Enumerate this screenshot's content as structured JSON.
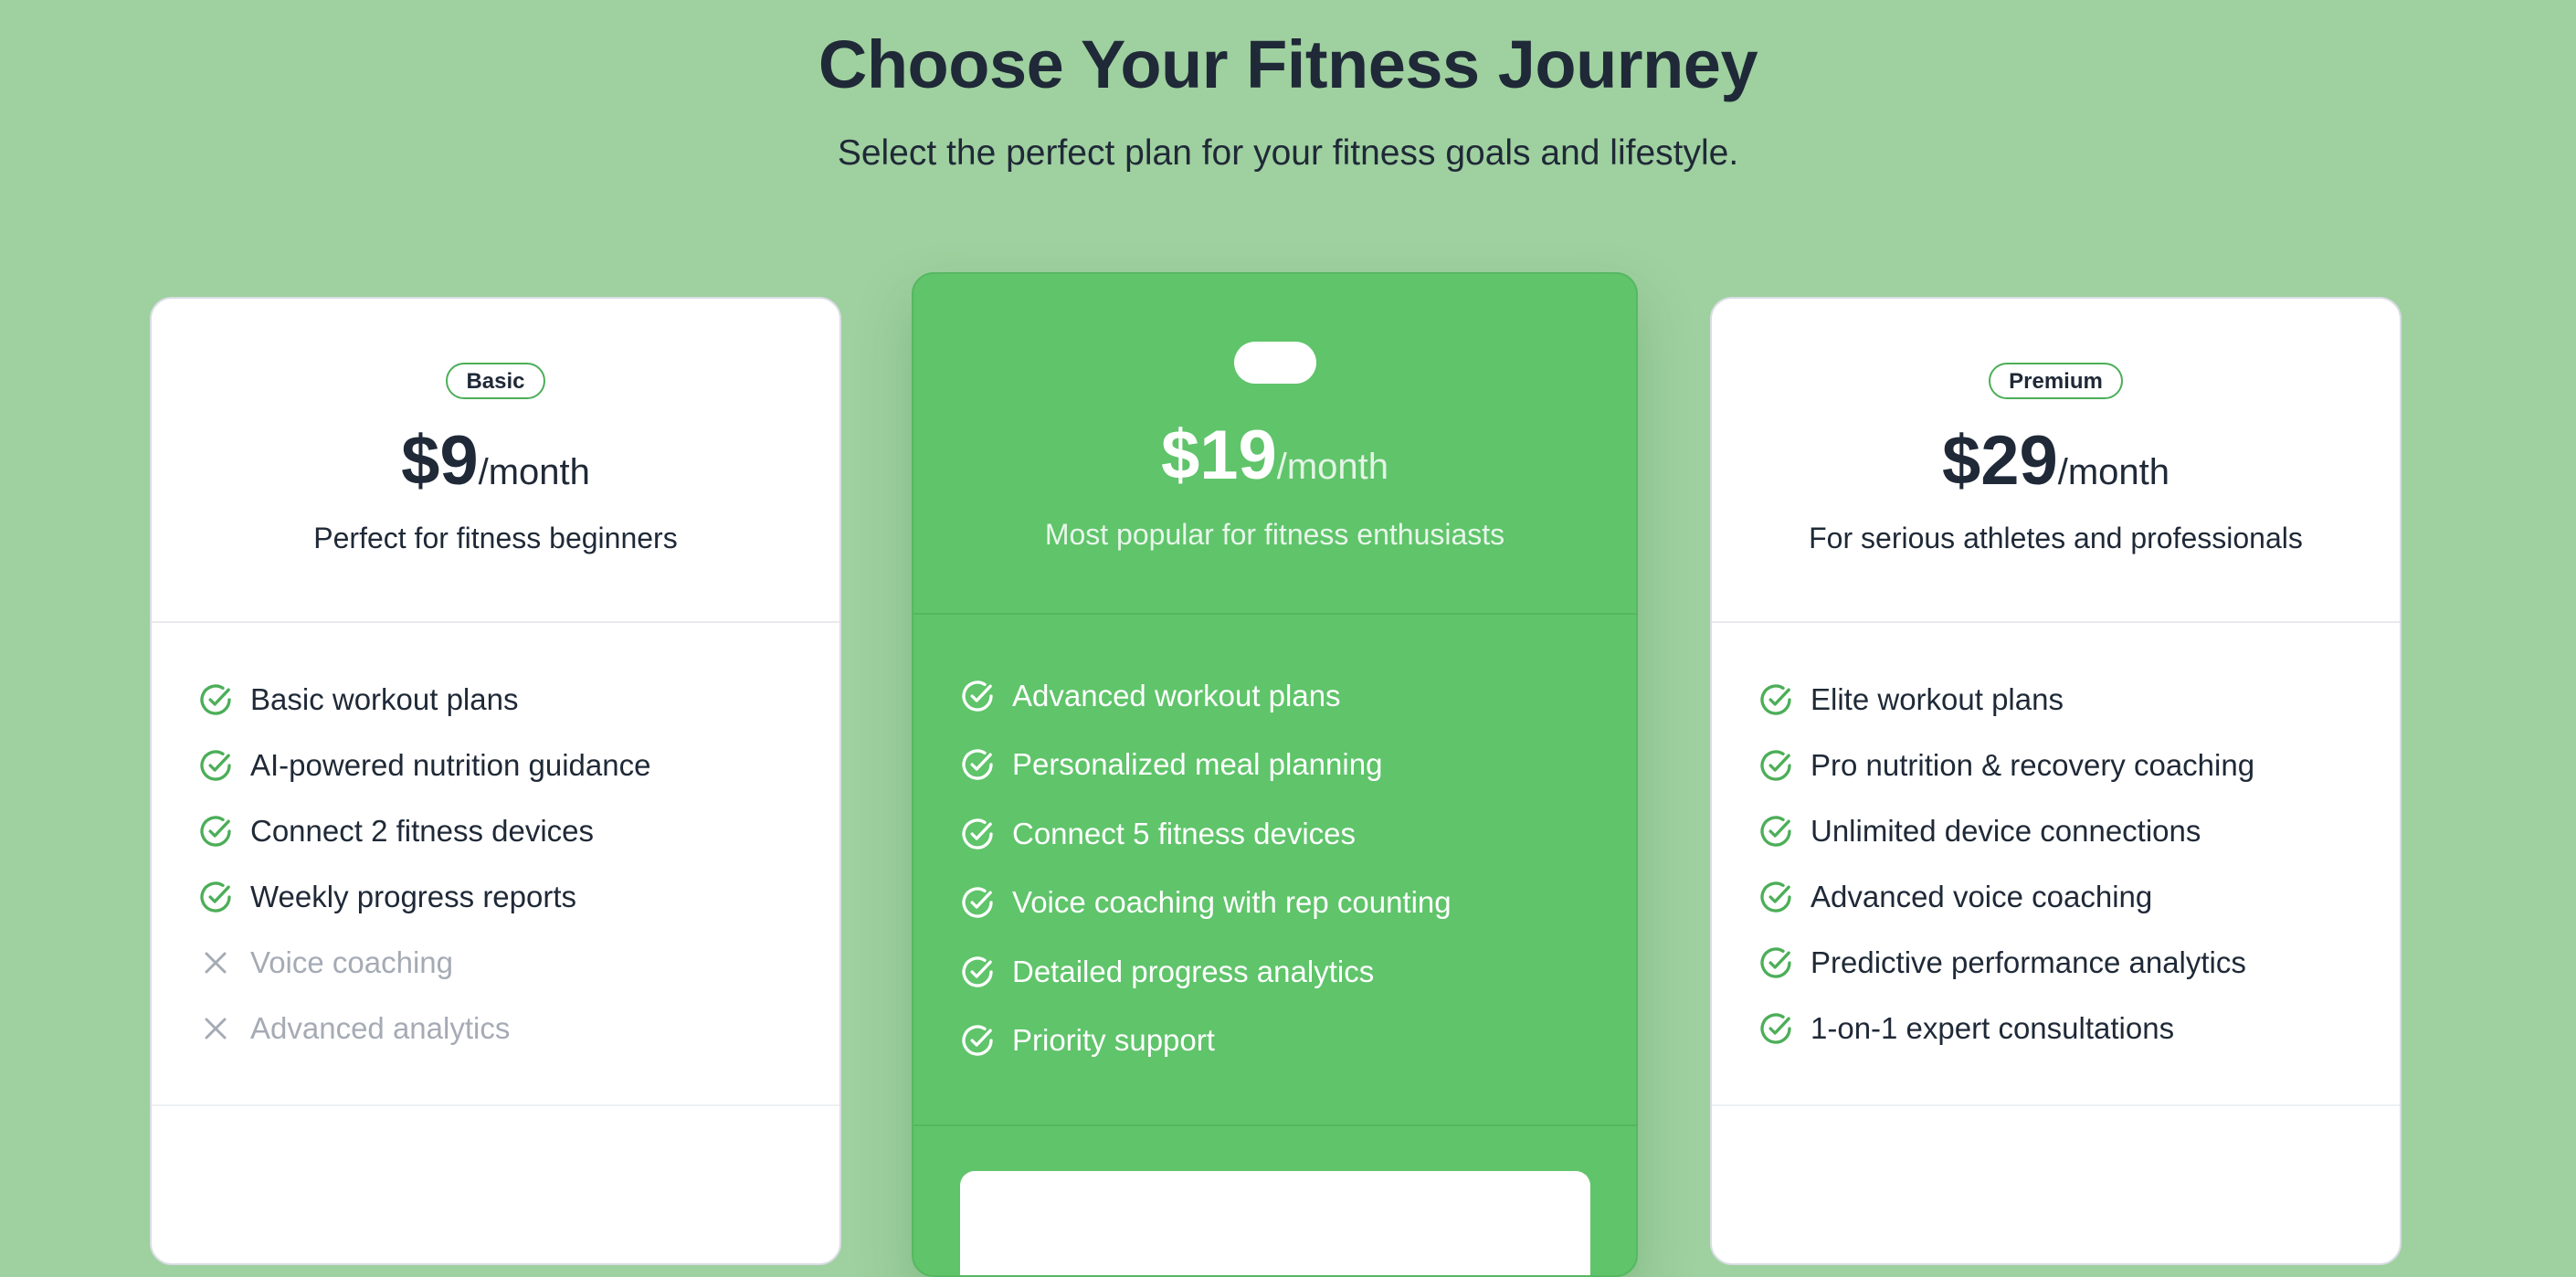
{
  "header": {
    "title": "Choose Your Fitness Journey",
    "subtitle": "Select the perfect plan for your fitness goals and lifestyle."
  },
  "colors": {
    "background": "#9fd09f",
    "accent": "#5fc46a",
    "check": "#4cae58",
    "disabled": "#a5abb5"
  },
  "plans": [
    {
      "badge": "Basic",
      "price": "$9",
      "period": "/month",
      "tagline": "Perfect for fitness beginners",
      "features": [
        {
          "label": "Basic workout plans",
          "included": true,
          "icon": "check-circle-icon"
        },
        {
          "label": "AI-powered nutrition guidance",
          "included": true,
          "icon": "check-circle-icon"
        },
        {
          "label": "Connect 2 fitness devices",
          "included": true,
          "icon": "check-circle-icon"
        },
        {
          "label": "Weekly progress reports",
          "included": true,
          "icon": "check-circle-icon"
        },
        {
          "label": "Voice coaching",
          "included": false,
          "icon": "x-icon"
        },
        {
          "label": "Advanced analytics",
          "included": false,
          "icon": "x-icon"
        }
      ]
    },
    {
      "badge": "",
      "price": "$19",
      "period": "/month",
      "tagline": "Most popular for fitness enthusiasts",
      "features": [
        {
          "label": "Advanced workout plans",
          "included": true,
          "icon": "check-circle-icon"
        },
        {
          "label": "Personalized meal planning",
          "included": true,
          "icon": "check-circle-icon"
        },
        {
          "label": "Connect 5 fitness devices",
          "included": true,
          "icon": "check-circle-icon"
        },
        {
          "label": "Voice coaching with rep counting",
          "included": true,
          "icon": "check-circle-icon"
        },
        {
          "label": "Detailed progress analytics",
          "included": true,
          "icon": "check-circle-icon"
        },
        {
          "label": "Priority support",
          "included": true,
          "icon": "check-circle-icon"
        }
      ]
    },
    {
      "badge": "Premium",
      "price": "$29",
      "period": "/month",
      "tagline": "For serious athletes and professionals",
      "features": [
        {
          "label": "Elite workout plans",
          "included": true,
          "icon": "check-circle-icon"
        },
        {
          "label": "Pro nutrition & recovery coaching",
          "included": true,
          "icon": "check-circle-icon"
        },
        {
          "label": "Unlimited device connections",
          "included": true,
          "icon": "check-circle-icon"
        },
        {
          "label": "Advanced voice coaching",
          "included": true,
          "icon": "check-circle-icon"
        },
        {
          "label": "Predictive performance analytics",
          "included": true,
          "icon": "check-circle-icon"
        },
        {
          "label": "1-on-1 expert consultations",
          "included": true,
          "icon": "check-circle-icon"
        }
      ]
    }
  ]
}
